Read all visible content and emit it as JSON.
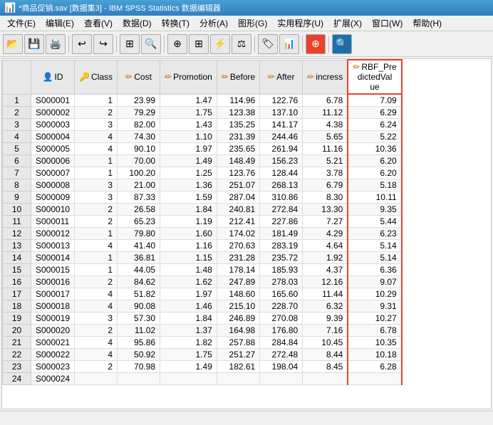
{
  "titleBar": {
    "icon": "📊",
    "title": "*商品促销.sav [数据集3] - IBM SPSS Statistics 数据编辑器"
  },
  "menuBar": {
    "items": [
      {
        "label": "文件(E)"
      },
      {
        "label": "编辑(E)"
      },
      {
        "label": "查看(V)"
      },
      {
        "label": "数据(D)"
      },
      {
        "label": "转换(T)"
      },
      {
        "label": "分析(A)"
      },
      {
        "label": "图形(G)"
      },
      {
        "label": "实用程序(U)"
      },
      {
        "label": "扩展(X)"
      },
      {
        "label": "窗口(W)"
      },
      {
        "label": "帮助(H)"
      }
    ]
  },
  "table": {
    "columns": [
      {
        "id": "rownum",
        "label": "",
        "icon": ""
      },
      {
        "id": "ID",
        "label": "ID",
        "icon": "👤"
      },
      {
        "id": "Class",
        "label": "Class",
        "icon": "🔑"
      },
      {
        "id": "Cost",
        "label": "Cost",
        "icon": "✏️"
      },
      {
        "id": "Promotion",
        "label": "Promotion",
        "icon": "✏️"
      },
      {
        "id": "Before",
        "label": "Before",
        "icon": "✏️"
      },
      {
        "id": "After",
        "label": "After",
        "icon": "✏️"
      },
      {
        "id": "incress",
        "label": "incress",
        "icon": "✏️"
      },
      {
        "id": "RBF_PredictedValue",
        "label": "RBF_Pre\ndictedVal\nue",
        "icon": "✏️"
      }
    ],
    "rows": [
      [
        1,
        "S000001",
        1,
        "23.99",
        "1.47",
        "114.96",
        "122.76",
        "6.78",
        "7.09"
      ],
      [
        2,
        "S000002",
        2,
        "79.29",
        "1.75",
        "123.38",
        "137.10",
        "11.12",
        "6.29"
      ],
      [
        3,
        "S000003",
        3,
        "82.00",
        "1.43",
        "135.25",
        "141.17",
        "4.38",
        "6.24"
      ],
      [
        4,
        "S000004",
        4,
        "74.30",
        "1.10",
        "231.39",
        "244.46",
        "5.65",
        "5.22"
      ],
      [
        5,
        "S000005",
        4,
        "90.10",
        "1.97",
        "235.65",
        "261.94",
        "11.16",
        "10.36"
      ],
      [
        6,
        "S000006",
        1,
        "70.00",
        "1.49",
        "148.49",
        "156.23",
        "5.21",
        "6.20"
      ],
      [
        7,
        "S000007",
        1,
        "100.20",
        "1.25",
        "123.76",
        "128.44",
        "3.78",
        "6.20"
      ],
      [
        8,
        "S000008",
        3,
        "21.00",
        "1.36",
        "251.07",
        "268.13",
        "6.79",
        "5.18"
      ],
      [
        9,
        "S000009",
        3,
        "87.33",
        "1.59",
        "287.04",
        "310.86",
        "8.30",
        "10.11"
      ],
      [
        10,
        "S000010",
        2,
        "26.58",
        "1.84",
        "240.81",
        "272.84",
        "13.30",
        "9.35"
      ],
      [
        11,
        "S000011",
        2,
        "65.23",
        "1.19",
        "212.41",
        "227.86",
        "7.27",
        "5.44"
      ],
      [
        12,
        "S000012",
        1,
        "79.80",
        "1.60",
        "174.02",
        "181.49",
        "4.29",
        "6.23"
      ],
      [
        13,
        "S000013",
        4,
        "41.40",
        "1.16",
        "270.63",
        "283.19",
        "4.64",
        "5.14"
      ],
      [
        14,
        "S000014",
        1,
        "36.81",
        "1.15",
        "231.28",
        "235.72",
        "1.92",
        "5.14"
      ],
      [
        15,
        "S000015",
        1,
        "44.05",
        "1.48",
        "178.14",
        "185.93",
        "4.37",
        "6.36"
      ],
      [
        16,
        "S000016",
        2,
        "84.62",
        "1.62",
        "247.89",
        "278.03",
        "12.16",
        "9.07"
      ],
      [
        17,
        "S000017",
        4,
        "51.82",
        "1.97",
        "148.60",
        "165.60",
        "11.44",
        "10.29"
      ],
      [
        18,
        "S000018",
        4,
        "90.08",
        "1.46",
        "215.10",
        "228.70",
        "6.32",
        "9.31"
      ],
      [
        19,
        "S000019",
        3,
        "57.30",
        "1.84",
        "246.89",
        "270.08",
        "9.39",
        "10.27"
      ],
      [
        20,
        "S000020",
        2,
        "11.02",
        "1.37",
        "164.98",
        "176.80",
        "7.16",
        "6.78"
      ],
      [
        21,
        "S000021",
        4,
        "95.86",
        "1.82",
        "257.88",
        "284.84",
        "10.45",
        "10.35"
      ],
      [
        22,
        "S000022",
        4,
        "50.92",
        "1.75",
        "251.27",
        "272.48",
        "8.44",
        "10.18"
      ],
      [
        23,
        "S000023",
        2,
        "70.98",
        "1.49",
        "182.61",
        "198.04",
        "8.45",
        "6.28"
      ],
      [
        24,
        "S000024",
        "",
        "",
        "",
        "",
        "",
        "",
        ""
      ]
    ]
  },
  "statusBar": {
    "text": ""
  }
}
